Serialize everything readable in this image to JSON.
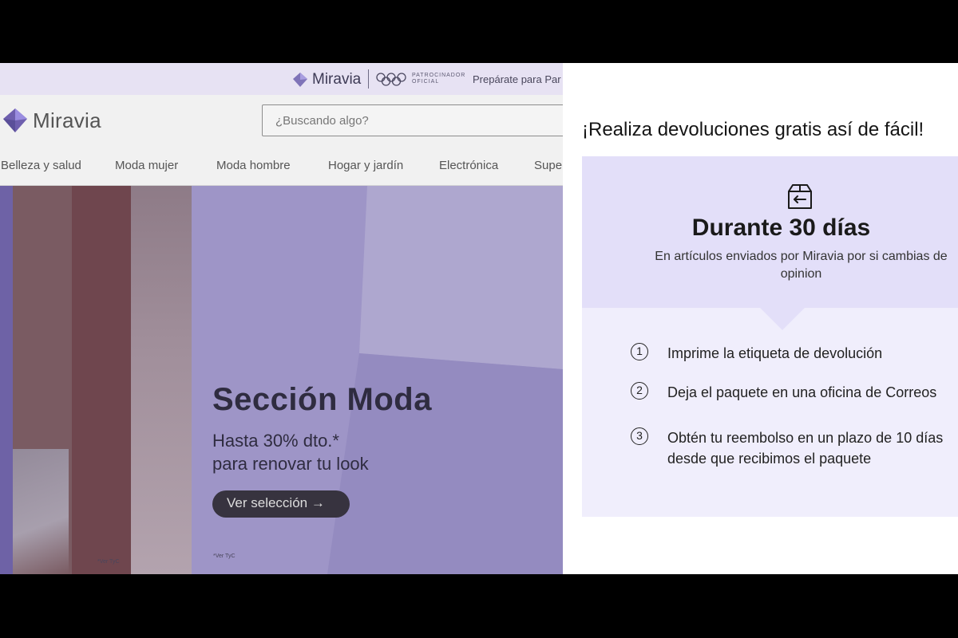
{
  "site": {
    "topbar": {
      "logo_text": "Miravia",
      "sponsor_line1": "PATROCINADOR",
      "sponsor_line2": "OFICIAL",
      "promo_text": "Prepárate para Par"
    },
    "header": {
      "logo_text": "Miravia",
      "search_placeholder": "¿Buscando algo?"
    },
    "nav": {
      "items": [
        "Belleza y salud",
        "Moda mujer",
        "Moda hombre",
        "Hogar y jardín",
        "Electrónica",
        "Super"
      ]
    },
    "hero": {
      "title": "Sección Moda",
      "subtitle_line1": "Hasta 30% dto.*",
      "subtitle_line2": "para renovar tu look",
      "button_label": "Ver selección →",
      "tyc_left": "*Ver TyC",
      "tyc_right": "*Ver TyC"
    }
  },
  "panel": {
    "title": "¡Realiza devoluciones gratis así de fácil!",
    "heading": "Durante 30 días",
    "description": "En artículos enviados por Miravia por si cambias de opinion",
    "steps": [
      {
        "number": "1",
        "text": "Imprime la etiqueta de devolución"
      },
      {
        "number": "2",
        "text": "Deja el paquete en una oficina de Correos"
      },
      {
        "number": "3",
        "text": "Obtén tu reembolso en un plazo de 10 días desde que recibimos el paquete"
      }
    ]
  },
  "colors": {
    "brand_purple": "#7b5cf0",
    "panel_lavender": "#e3dff9",
    "panel_lavender_light": "#f0eefc",
    "overlay_tint": "#a49bc9"
  },
  "icons": {
    "box": "return-box-icon",
    "logo": "miravia-logo-icon",
    "olympic": "olympic-rings-icon"
  }
}
